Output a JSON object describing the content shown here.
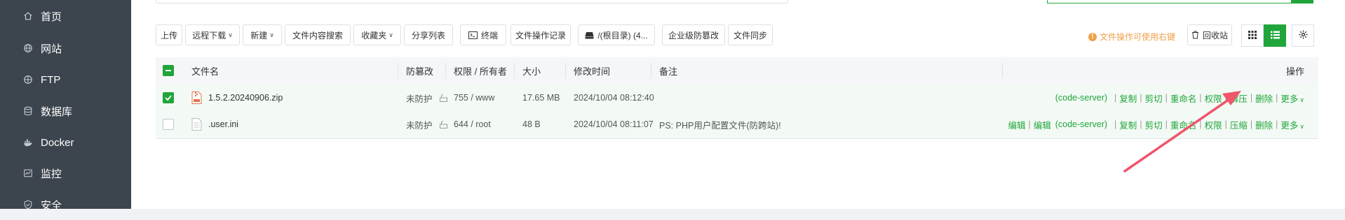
{
  "sidebar": {
    "items": [
      {
        "label": "首页",
        "icon": "home-icon"
      },
      {
        "label": "网站",
        "icon": "globe-icon"
      },
      {
        "label": "FTP",
        "icon": "ftp-icon"
      },
      {
        "label": "数据库",
        "icon": "database-icon"
      },
      {
        "label": "Docker",
        "icon": "docker-icon"
      },
      {
        "label": "监控",
        "icon": "monitor-icon"
      },
      {
        "label": "安全",
        "icon": "shield-icon"
      }
    ]
  },
  "toolbar": {
    "upload": "上传",
    "remote_download": "远程下载",
    "new": "新建",
    "content_search": "文件内容搜索",
    "favorites": "收藏夹",
    "share_list": "分享列表",
    "terminal": "终端",
    "operation_log": "文件操作记录",
    "root_path": "/(根目录) (4...",
    "enterprise_tamper": "企业级防篡改",
    "file_sync": "文件同步",
    "hint": "文件操作可使用右键",
    "recycle_bin": "回收站"
  },
  "table": {
    "headers": {
      "name": "文件名",
      "tamper": "防篡改",
      "perm": "权限 / 所有者",
      "size": "大小",
      "mtime": "修改时间",
      "note": "备注",
      "ops": "操作"
    },
    "rows": [
      {
        "name": "1.5.2.20240906.zip",
        "tamper": "未防护",
        "perm": "755 / www",
        "size": "17.65 MB",
        "mtime": "2024/10/04 08:12:40",
        "note": "",
        "checked": true,
        "ops": [
          "(code-server)",
          "复制",
          "剪切",
          "重命名",
          "权限",
          "解压",
          "删除",
          "更多"
        ]
      },
      {
        "name": ".user.ini",
        "tamper": "未防护",
        "perm": "644 / root",
        "size": "48 B",
        "mtime": "2024/10/04 08:11:07",
        "note": "PS: PHP用户配置文件(防跨站)!",
        "checked": false,
        "ops": [
          "编辑",
          "编辑",
          "(code-server)",
          "复制",
          "剪切",
          "重命名",
          "权限",
          "压缩",
          "删除",
          "更多"
        ]
      }
    ]
  },
  "colors": {
    "accent": "#20a53a",
    "sidebar_bg": "#3c444d",
    "warning": "#f0a04b",
    "annotation_arrow": "#f0556a"
  }
}
